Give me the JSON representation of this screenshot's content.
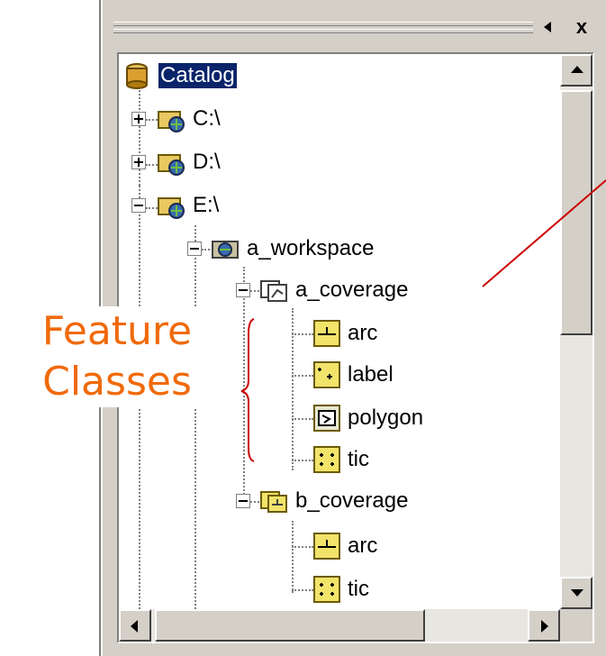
{
  "panel": {
    "title_bar": {
      "pin_icon": "pin-icon",
      "close_label": "x"
    },
    "tree": {
      "root": "Catalog",
      "drives": [
        "C:\\",
        "D:\\",
        "E:\\"
      ],
      "workspace": "a_workspace",
      "coverages": [
        {
          "name": "a_coverage",
          "feature_classes": [
            "arc",
            "label",
            "polygon",
            "tic"
          ]
        },
        {
          "name": "b_coverage",
          "feature_classes": [
            "arc",
            "tic"
          ]
        }
      ]
    }
  },
  "annotation": {
    "line1": "Feature",
    "line2": "Classes",
    "color": "#f06a0a",
    "pointer_color": "#cc0000"
  }
}
